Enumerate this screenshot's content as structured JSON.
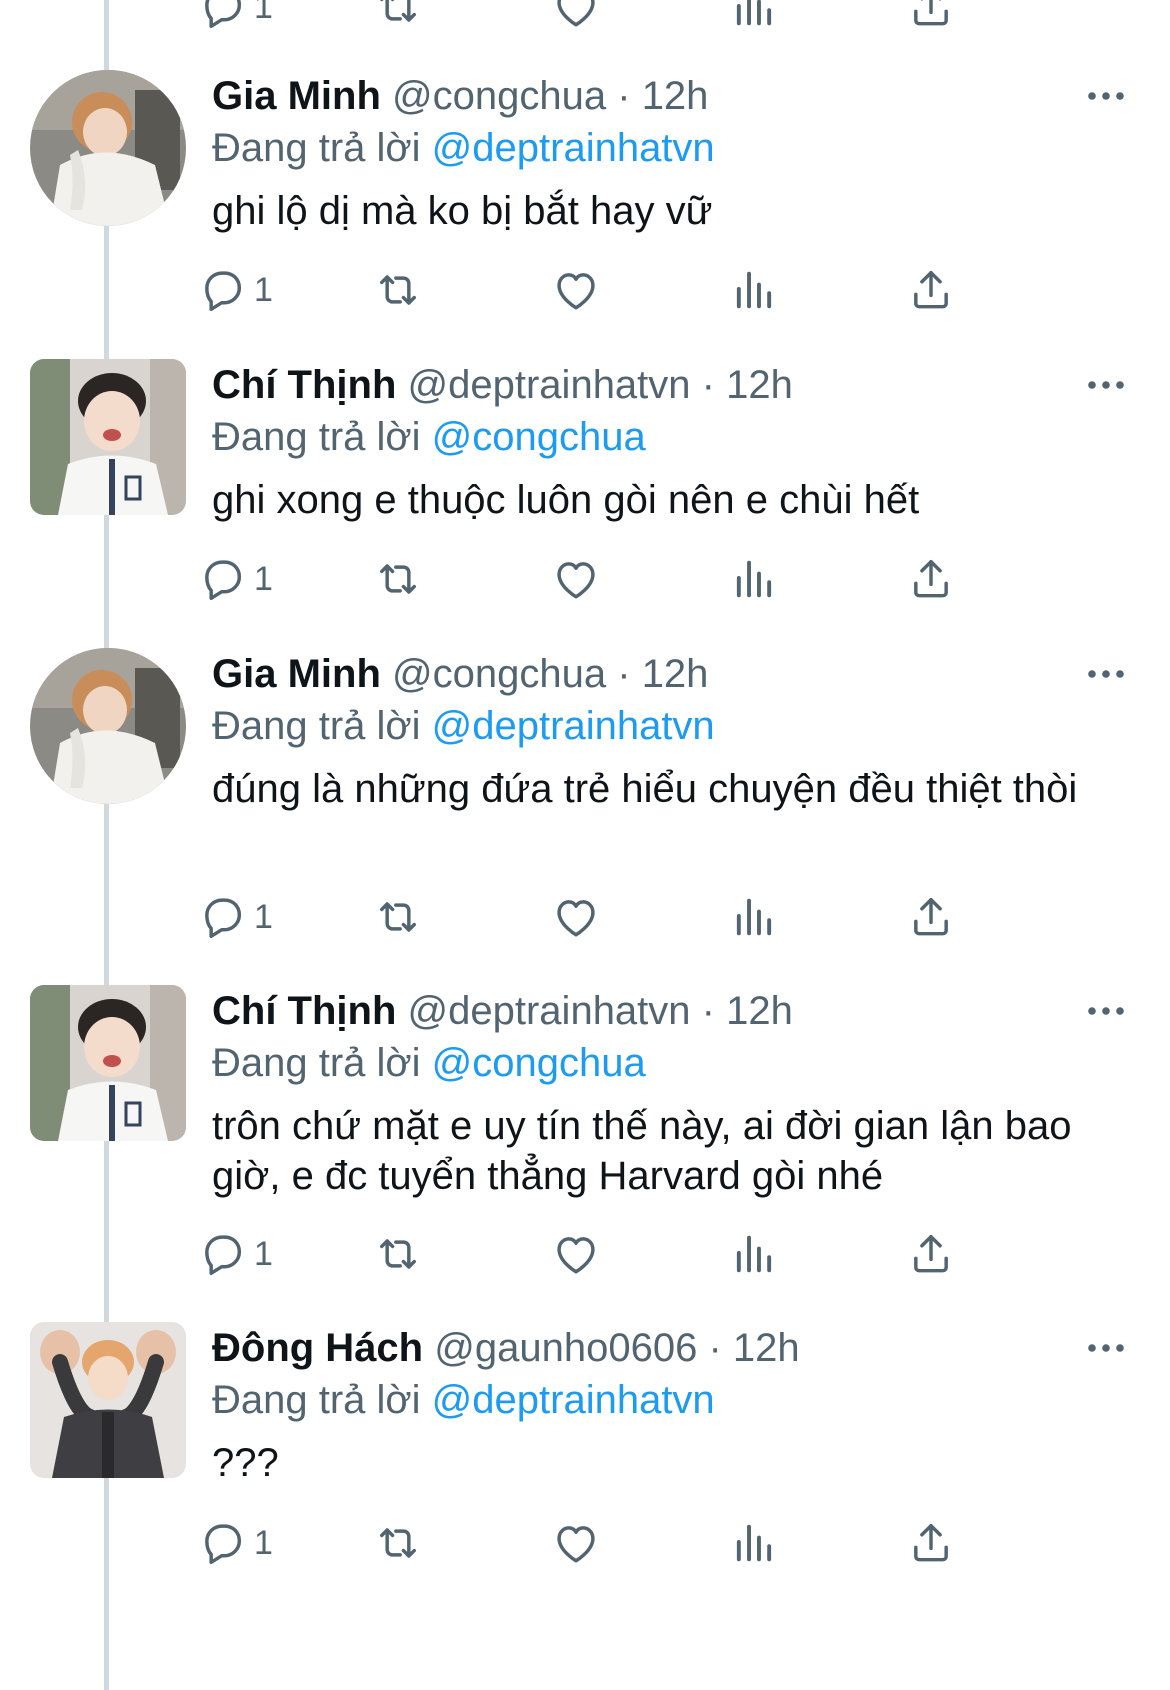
{
  "top_actions": {
    "reply_count": "1"
  },
  "tweets": [
    {
      "name": "Gia Minh",
      "handle": "@congchua",
      "time": "12h",
      "replying_label": "Đang trả lời",
      "replying_to": "@deptrainhatvn",
      "text": "ghi lộ dị mà ko bị bắt hay vữ",
      "reply_count": "1",
      "avatar": "avatar-gia-minh"
    },
    {
      "name": "Chí Thịnh",
      "handle": "@deptrainhatvn",
      "time": "12h",
      "replying_label": "Đang trả lời",
      "replying_to": "@congchua",
      "text": "ghi xong e thuộc luôn gòi nên e chùi hết",
      "reply_count": "1",
      "avatar": "avatar-chi-thinh"
    },
    {
      "name": "Gia Minh",
      "handle": "@congchua",
      "time": "12h",
      "replying_label": "Đang trả lời",
      "replying_to": "@deptrainhatvn",
      "text": "đúng là những đứa trẻ hiểu chuyện đều thiệt thòi",
      "reply_count": "1",
      "avatar": "avatar-gia-minh"
    },
    {
      "name": "Chí Thịnh",
      "handle": "@deptrainhatvn",
      "time": "12h",
      "replying_label": "Đang trả lời",
      "replying_to": "@congchua",
      "text": "trôn chứ mặt e uy tín thế này, ai đời gian lận bao giờ, e đc tuyển thẳng Harvard gòi nhé",
      "reply_count": "1",
      "avatar": "avatar-chi-thinh"
    },
    {
      "name": "Đông Hách",
      "handle": "@gaunho0606",
      "time": "12h",
      "replying_label": "Đang trả lời",
      "replying_to": "@deptrainhatvn",
      "text": "???",
      "reply_count": "1",
      "avatar": "avatar-dong-hach"
    }
  ],
  "separator": "·",
  "colors": {
    "text": "#0f1419",
    "muted": "#536471",
    "accent": "#1d9bf0",
    "thread_line": "#cfd9de"
  },
  "icons": [
    "reply-icon",
    "retweet-icon",
    "like-icon",
    "views-icon",
    "share-icon",
    "more-icon"
  ]
}
